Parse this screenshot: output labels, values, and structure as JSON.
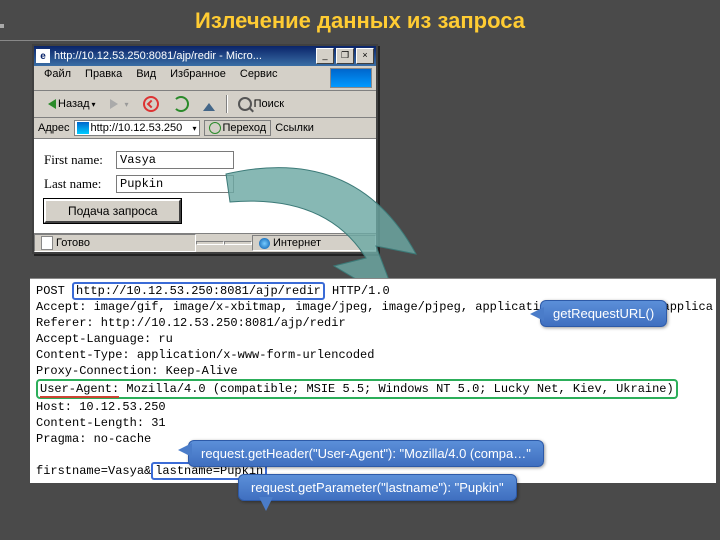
{
  "slide": {
    "title": "Излечение данных из запроса"
  },
  "browser": {
    "title": "http://10.12.53.250:8081/ajp/redir - Micro...",
    "winbtns": {
      "min": "_",
      "max": "❐",
      "close": "×"
    },
    "menu": {
      "file": "Файл",
      "edit": "Правка",
      "view": "Вид",
      "fav": "Избранное",
      "tools": "Сервис"
    },
    "toolbar": {
      "back": "Назад",
      "search": "Поиск"
    },
    "addr": {
      "label": "Адрес",
      "url": "http://10.12.53.250",
      "go": "Переход",
      "links": "Ссылки"
    },
    "form": {
      "first_label": "First name:",
      "first_value": "Vasya",
      "last_label": "Last name:",
      "last_value": "Pupkin",
      "submit": "Подача запроса"
    },
    "status": {
      "ready": "Готово",
      "zone": "Интернет"
    }
  },
  "http": {
    "line1a": "POST ",
    "line1b": "http://10.12.53.250:8081/ajp/redir",
    "line1c": " HTTP/1.0",
    "line2": "Accept: image/gif, image/x-xbitmap, image/jpeg, image/pjpeg, application/vnd.ms-excel, applica",
    "line3": "Referer: http://10.12.53.250:8081/ajp/redir",
    "line4": "Accept-Language: ru",
    "line5": "Content-Type: application/x-www-form-urlencoded",
    "line6": "Proxy-Connection: Keep-Alive",
    "line7a": "User-Agent:",
    "line7b": " Mozilla/4.0 (compatible; MSIE 5.5; Windows NT 5.0; Lucky Net, Kiev, Ukraine)",
    "line8": "Host: 10.12.53.250",
    "line9": "Content-Length: 31",
    "line10": "Pragma: no-cache",
    "line12a": "firstname=Vasya&",
    "line12b": "lastname=Pupkin"
  },
  "callouts": {
    "c1": "getRequestURL()",
    "c2": "request.getHeader(\"User-Agent\"): \"Mozilla/4.0 (compa…\"",
    "c3": "request.getParameter(\"lastname\"): \"Pupkin\""
  }
}
